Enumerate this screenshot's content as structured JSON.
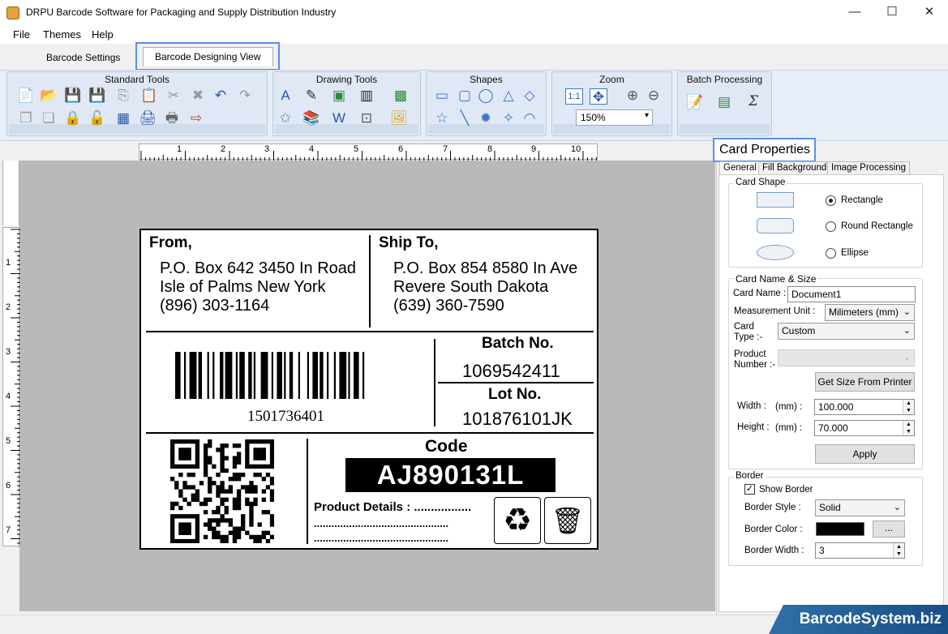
{
  "window": {
    "title": "DRPU Barcode Software for Packaging and Supply Distribution Industry",
    "minimize_glyph": "—",
    "maximize_glyph": "☐",
    "close_glyph": "✕"
  },
  "menu": {
    "file": "File",
    "themes": "Themes",
    "help": "Help"
  },
  "tabs": {
    "settings": "Barcode Settings",
    "design": "Barcode Designing View"
  },
  "ribbon": {
    "standard_tools": "Standard Tools",
    "drawing_tools": "Drawing Tools",
    "shapes": "Shapes",
    "zoom": "Zoom",
    "zoom_value": "150%",
    "zoom_fit_label": "1:1",
    "batch_processing": "Batch Processing"
  },
  "ruler": {
    "h": [
      "1",
      "2",
      "3",
      "4",
      "5",
      "6",
      "7",
      "8",
      "9",
      "10"
    ],
    "v": [
      "1",
      "2",
      "3",
      "4",
      "5",
      "6",
      "7"
    ]
  },
  "label": {
    "from_heading": "From,",
    "from_line1": "P.O. Box 642 3450 In Road",
    "from_line2": "Isle of Palms New York",
    "from_line3": "(896) 303-1164",
    "ship_heading": "Ship To,",
    "ship_line1": "P.O. Box 854 8580 In Ave",
    "ship_line2": "Revere South Dakota",
    "ship_line3": "(639) 360-7590",
    "barcode_number": "1501736401",
    "batch_heading": "Batch No.",
    "batch_value": "1069542411",
    "lot_heading": "Lot No.",
    "lot_value": "101876101JK",
    "code_heading": "Code",
    "code_value": "AJ890131L",
    "product_details": "Product Details : .................",
    "dots_line1": "..............................................",
    "dots_line2": "..............................................",
    "recycle_glyph": "♻",
    "trash_glyph": "🗑"
  },
  "panel": {
    "title": "Card Properties",
    "tab_general": "General",
    "tab_fill": "Fill Background",
    "tab_image": "Image Processing",
    "card_shape_legend": "Card Shape",
    "shape_rect": "Rectangle",
    "shape_round": "Round Rectangle",
    "shape_ellipse": "Ellipse",
    "name_size_legend": "Card  Name & Size",
    "card_name_label": "Card Name :",
    "card_name_value": "Document1",
    "unit_label": "Measurement Unit :",
    "unit_value": "Milimeters (mm)",
    "card_type_label": "Card\nType :-",
    "card_type_value": "Custom",
    "product_number_label": "Product\nNumber :-",
    "get_size_button": "Get Size From Printer",
    "width_label": "Width :",
    "height_label": "Height :",
    "unit_mm": "(mm) :",
    "width_value": "100.000",
    "height_value": "70.000",
    "apply_button": "Apply",
    "border_legend": "Border",
    "show_border": "Show Border",
    "border_style_label": "Border Style :",
    "border_style_value": "Solid",
    "border_color_label": "Border Color :",
    "border_color_value": "#000000",
    "border_color_button": "...",
    "border_width_label": "Border Width :",
    "border_width_value": "3"
  },
  "brand": "BarcodeSystem.biz"
}
